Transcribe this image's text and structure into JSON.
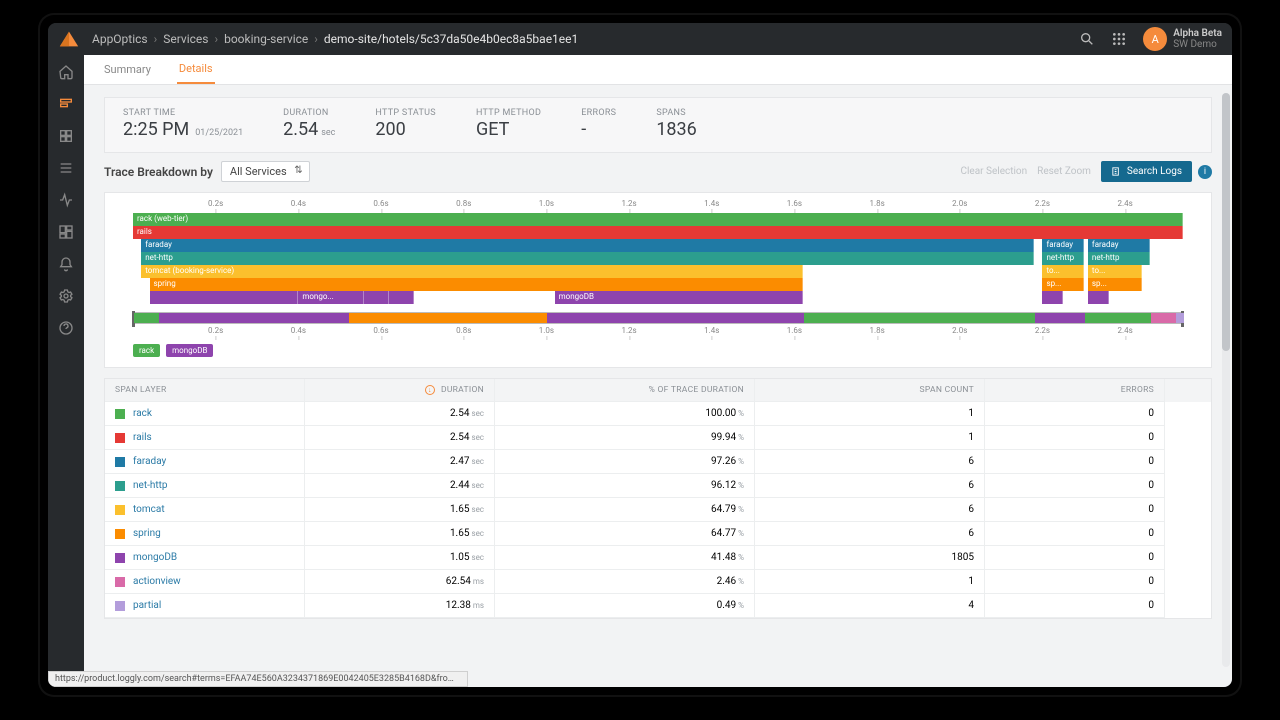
{
  "colors": {
    "accent": "#f58b3c",
    "rack": "#4caf50",
    "rails": "#e53935",
    "faraday": "#1f7aa5",
    "nethttp": "#2c9e8e",
    "tomcat": "#fbc02d",
    "spring": "#fb8c00",
    "mongo": "#8e44ad",
    "action": "#d96aa8",
    "partial": "#b39ddb"
  },
  "header": {
    "breadcrumb": [
      "AppOptics",
      "Services",
      "booking-service",
      "demo-site/hotels/5c37da50e4b0ec8a5bae1ee1"
    ],
    "user": {
      "initial": "A",
      "name": "Alpha Beta",
      "org": "SW Demo"
    }
  },
  "tabs": [
    "Summary",
    "Details"
  ],
  "metrics": [
    {
      "label": "START TIME",
      "value": "2:25 PM",
      "sub": "01/25/2021"
    },
    {
      "label": "DURATION",
      "value": "2.54",
      "unit": "sec"
    },
    {
      "label": "HTTP STATUS",
      "value": "200"
    },
    {
      "label": "HTTP METHOD",
      "value": "GET"
    },
    {
      "label": "ERRORS",
      "value": "-"
    },
    {
      "label": "SPANS",
      "value": "1836"
    }
  ],
  "breakdown": {
    "title": "Trace Breakdown by",
    "selector": "All Services",
    "clear": "Clear Selection",
    "reset": "Reset Zoom",
    "search_logs": "Search Logs"
  },
  "ticks": [
    "0.2s",
    "0.4s",
    "0.6s",
    "0.8s",
    "1.0s",
    "1.2s",
    "1.4s",
    "1.6s",
    "1.8s",
    "2.0s",
    "2.2s",
    "2.4s"
  ],
  "chart_data": {
    "type": "flame-timeline",
    "x_unit": "s",
    "x_range": [
      0,
      2.54
    ],
    "lanes": [
      {
        "row": 0,
        "bars": [
          {
            "label": "rack (web-tier)",
            "start": 0.0,
            "end": 2.54,
            "colorKey": "rack"
          }
        ]
      },
      {
        "row": 1,
        "bars": [
          {
            "label": "rails",
            "start": 0.0,
            "end": 2.54,
            "colorKey": "rails"
          }
        ]
      },
      {
        "row": 2,
        "bars": [
          {
            "label": "faraday",
            "start": 0.02,
            "end": 2.18,
            "colorKey": "faraday"
          },
          {
            "label": "faraday",
            "start": 2.2,
            "end": 2.3,
            "colorKey": "faraday"
          },
          {
            "label": "faraday",
            "start": 2.31,
            "end": 2.46,
            "colorKey": "faraday"
          }
        ]
      },
      {
        "row": 3,
        "bars": [
          {
            "label": "net-http",
            "start": 0.02,
            "end": 2.18,
            "colorKey": "nethttp"
          },
          {
            "label": "net-http",
            "start": 2.2,
            "end": 2.3,
            "colorKey": "nethttp"
          },
          {
            "label": "net-http",
            "start": 2.31,
            "end": 2.46,
            "colorKey": "nethttp"
          }
        ]
      },
      {
        "row": 4,
        "bars": [
          {
            "label": "tomcat (booking-service)",
            "start": 0.02,
            "end": 1.62,
            "colorKey": "tomcat"
          },
          {
            "label": "to...",
            "start": 2.2,
            "end": 2.3,
            "colorKey": "tomcat"
          },
          {
            "label": "to...",
            "start": 2.31,
            "end": 2.44,
            "colorKey": "tomcat"
          }
        ]
      },
      {
        "row": 5,
        "bars": [
          {
            "label": "spring",
            "start": 0.04,
            "end": 1.62,
            "colorKey": "spring"
          },
          {
            "label": "sp...",
            "start": 2.2,
            "end": 2.3,
            "colorKey": "spring"
          },
          {
            "label": "sp...",
            "start": 2.31,
            "end": 2.44,
            "colorKey": "spring"
          }
        ]
      },
      {
        "row": 6,
        "bars": [
          {
            "label": "",
            "start": 0.04,
            "end": 0.4,
            "colorKey": "mongo"
          },
          {
            "label": "mongo...",
            "start": 0.4,
            "end": 0.56,
            "colorKey": "mongo"
          },
          {
            "label": "",
            "start": 0.56,
            "end": 0.62,
            "colorKey": "mongo"
          },
          {
            "label": "",
            "start": 0.62,
            "end": 0.68,
            "colorKey": "mongo"
          },
          {
            "label": "mongoDB",
            "start": 1.02,
            "end": 1.62,
            "colorKey": "mongo"
          },
          {
            "label": "",
            "start": 2.2,
            "end": 2.25,
            "colorKey": "mongo"
          },
          {
            "label": "",
            "start": 2.31,
            "end": 2.36,
            "colorKey": "mongo"
          }
        ]
      }
    ],
    "minimap_segments": [
      {
        "start": 0.0,
        "end": 0.06,
        "colorKey": "rack"
      },
      {
        "start": 0.06,
        "end": 0.3,
        "colorKey": "mongo"
      },
      {
        "start": 0.3,
        "end": 0.52,
        "colorKey": "mongo"
      },
      {
        "start": 0.52,
        "end": 1.0,
        "colorKey": "spring"
      },
      {
        "start": 1.0,
        "end": 1.62,
        "colorKey": "mongo"
      },
      {
        "start": 1.62,
        "end": 2.18,
        "colorKey": "rack"
      },
      {
        "start": 2.18,
        "end": 2.3,
        "colorKey": "mongo"
      },
      {
        "start": 2.3,
        "end": 2.46,
        "colorKey": "rack"
      },
      {
        "start": 2.46,
        "end": 2.52,
        "colorKey": "action"
      },
      {
        "start": 2.52,
        "end": 2.54,
        "colorKey": "partial"
      }
    ],
    "legend_chips": [
      {
        "label": "rack",
        "colorKey": "rack"
      },
      {
        "label": "mongoDB",
        "colorKey": "mongo"
      }
    ]
  },
  "table": {
    "headers": [
      "SPAN LAYER",
      "DURATION",
      "% OF TRACE DURATION",
      "SPAN COUNT",
      "ERRORS"
    ],
    "rows": [
      {
        "colorKey": "rack",
        "name": "rack",
        "dur": "2.54",
        "du": "sec",
        "pct": "100.00",
        "cnt": "1",
        "err": "0"
      },
      {
        "colorKey": "rails",
        "name": "rails",
        "dur": "2.54",
        "du": "sec",
        "pct": "99.94",
        "cnt": "1",
        "err": "0"
      },
      {
        "colorKey": "faraday",
        "name": "faraday",
        "dur": "2.47",
        "du": "sec",
        "pct": "97.26",
        "cnt": "6",
        "err": "0"
      },
      {
        "colorKey": "nethttp",
        "name": "net-http",
        "dur": "2.44",
        "du": "sec",
        "pct": "96.12",
        "cnt": "6",
        "err": "0"
      },
      {
        "colorKey": "tomcat",
        "name": "tomcat",
        "dur": "1.65",
        "du": "sec",
        "pct": "64.79",
        "cnt": "6",
        "err": "0"
      },
      {
        "colorKey": "spring",
        "name": "spring",
        "dur": "1.65",
        "du": "sec",
        "pct": "64.77",
        "cnt": "6",
        "err": "0"
      },
      {
        "colorKey": "mongo",
        "name": "mongoDB",
        "dur": "1.05",
        "du": "sec",
        "pct": "41.48",
        "cnt": "1805",
        "err": "0"
      },
      {
        "colorKey": "action",
        "name": "actionview",
        "dur": "62.54",
        "du": "ms",
        "pct": "2.46",
        "cnt": "1",
        "err": "0"
      },
      {
        "colorKey": "partial",
        "name": "partial",
        "dur": "12.38",
        "du": "ms",
        "pct": "0.49",
        "cnt": "4",
        "err": "0"
      }
    ]
  },
  "status_url": "https://product.loggly.com/search#terms=EFAA74E560A3234371869E0042405E3285B4168D&from=-7d&until=now"
}
